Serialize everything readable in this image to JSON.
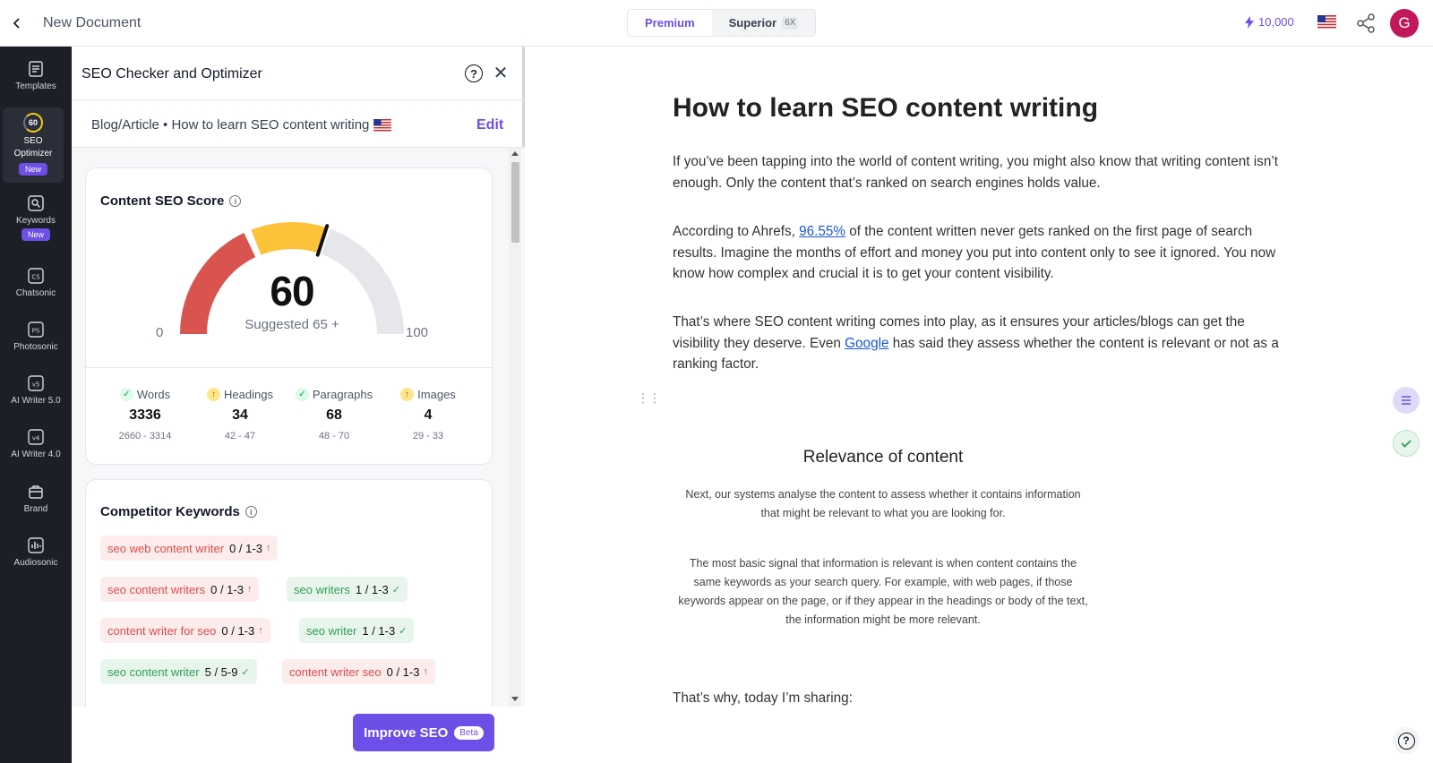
{
  "topbar": {
    "doc_title": "New Document",
    "plans": [
      {
        "label": "Premium",
        "active": true
      },
      {
        "label": "Superior",
        "badge": "6X",
        "active": false
      }
    ],
    "credits": "10,000",
    "avatar_letter": "G"
  },
  "sidebar": {
    "items": [
      {
        "label": "Templates",
        "icon": "templates-icon"
      },
      {
        "label": "SEO Optimizer",
        "score": "60",
        "badge": "New",
        "active": true
      },
      {
        "label": "Keywords",
        "icon": "keywords-icon",
        "badge": "New"
      },
      {
        "label": "Chatsonic",
        "icon": "chatsonic-icon",
        "glyph": "CS"
      },
      {
        "label": "Photosonic",
        "icon": "photosonic-icon",
        "glyph": "PS"
      },
      {
        "label": "AI Writer 5.0",
        "icon": "ai-writer-5-icon",
        "glyph": "v5"
      },
      {
        "label": "AI Writer 4.0",
        "icon": "ai-writer-4-icon",
        "glyph": "v4"
      },
      {
        "label": "Brand",
        "icon": "brand-icon"
      },
      {
        "label": "Audiosonic",
        "icon": "audiosonic-icon"
      }
    ]
  },
  "panel": {
    "title": "SEO Checker and Optimizer",
    "breadcrumb": "Blog/Article • How to learn SEO content writing",
    "edit_label": "Edit",
    "score_card": {
      "title": "Content SEO Score",
      "score": "60",
      "score_value": 60,
      "suggested": "Suggested  65 +",
      "min": "0",
      "max": "100",
      "colors": {
        "low": "#d9534f",
        "mid": "#fcc23a",
        "high": "#e5e7eb"
      }
    },
    "metrics": [
      {
        "label": "Words",
        "value": "3336",
        "range": "2660 - 3314",
        "status": "ok"
      },
      {
        "label": "Headings",
        "value": "34",
        "range": "42 - 47",
        "status": "up"
      },
      {
        "label": "Paragraphs",
        "value": "68",
        "range": "48 - 70",
        "status": "ok"
      },
      {
        "label": "Images",
        "value": "4",
        "range": "29 - 33",
        "status": "up"
      }
    ],
    "competitor_card": {
      "title": "Competitor Keywords",
      "keywords": [
        {
          "text": "seo web content writer",
          "count": "0 / 1-3",
          "status": "red"
        },
        {
          "text": "seo content writers",
          "count": "0 / 1-3",
          "status": "red"
        },
        {
          "text": "seo writers",
          "count": "1 / 1-3",
          "status": "green"
        },
        {
          "text": "content writer for seo",
          "count": "0 / 1-3",
          "status": "red"
        },
        {
          "text": "seo writer",
          "count": "1 / 1-3",
          "status": "green"
        },
        {
          "text": "seo content writer",
          "count": "5 / 5-9",
          "status": "green"
        },
        {
          "text": "content writer seo",
          "count": "0 / 1-3",
          "status": "red"
        }
      ]
    },
    "improve_label": "Improve SEO",
    "beta_label": "Beta"
  },
  "editor": {
    "heading": "How to learn SEO content writing",
    "p1": "If you’ve been tapping into the world of content writing, you might also know that writing content isn’t enough. Only the content that’s ranked on search engines holds value.",
    "p2_before": "According to Ahrefs, ",
    "p2_link": "96.55%",
    "p2_after": " of the content written never gets ranked on the first page of search results. Imagine the months of effort and money you put into content only to see it ignored. You now know how complex and crucial it is to get your content visibility.",
    "p3_before": "That’s where SEO content writing comes into play, as it ensures your articles/blogs can get the visibility they deserve. Even ",
    "p3_link": "Google",
    "p3_after": " has said they assess whether the content is relevant or not as a ranking factor.",
    "image": {
      "title": "Relevance of content",
      "p1": "Next, our systems analyse the content to assess whether it contains information that might be relevant to what you are looking for.",
      "p2": "The most basic signal that information is relevant is when content contains the same keywords as your search query. For example, with web pages, if those keywords appear on the page, or if they appear in the headings or body of the text, the information might be more relevant."
    },
    "p4": "That’s why, today I’m sharing:"
  }
}
